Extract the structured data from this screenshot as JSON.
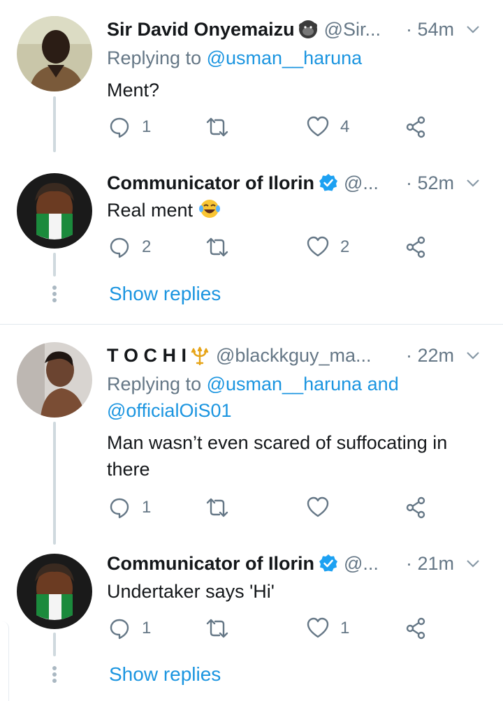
{
  "colors": {
    "link": "#1b95e0",
    "muted": "#657786",
    "verified": "#1da1f2"
  },
  "tweets": [
    {
      "name": "Sir David Onyemaizu",
      "handle": "@Sir...",
      "time": "· 54m",
      "replying_prefix": "Replying to",
      "replying_to": "@usman__haruna",
      "text": "Ment?",
      "reply_count": "1",
      "like_count": "4"
    },
    {
      "name": "Communicator of Ilorin",
      "handle": "@...",
      "time": "· 52m",
      "text": "Real ment",
      "emoji": "face-with-tears-of-joy",
      "reply_count": "2",
      "like_count": "2",
      "show_replies": "Show replies"
    },
    {
      "name": "T O C H I",
      "handle": "@blackkguy_ma...",
      "time": "· 22m",
      "replying_prefix": "Replying to",
      "replying_to": "@usman__haruna and",
      "replying_to_2": "@officialOiS01",
      "text": "Man wasn’t even scared of suffocating in",
      "text_2": "there",
      "reply_count": "1",
      "like_count": ""
    },
    {
      "name": "Communicator of Ilorin",
      "handle": "@...",
      "time": "· 21m",
      "text": "Undertaker says 'Hi'",
      "reply_count": "1",
      "like_count": "1",
      "show_replies": "Show replies"
    }
  ]
}
